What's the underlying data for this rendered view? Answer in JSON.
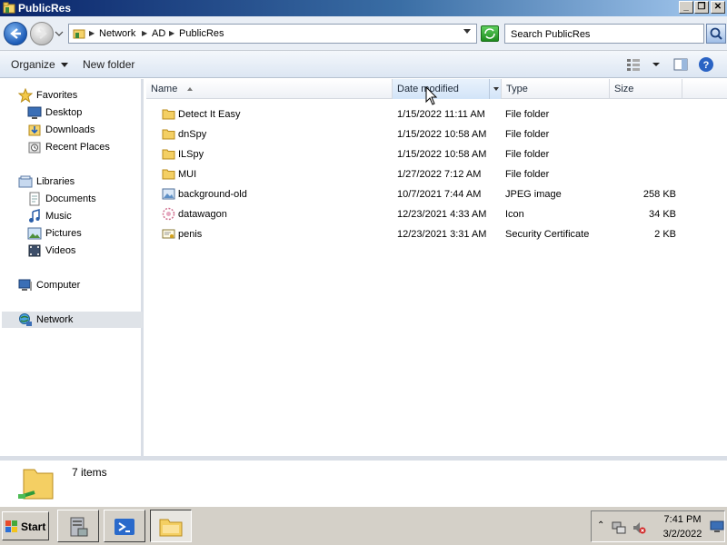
{
  "window": {
    "title": "PublicRes",
    "controls": [
      "minimize",
      "restore",
      "close"
    ]
  },
  "address": {
    "breadcrumbs": [
      "Network",
      "AD",
      "PublicRes"
    ],
    "search_placeholder": "Search PublicRes"
  },
  "toolbar": {
    "organize_label": "Organize",
    "new_folder_label": "New folder"
  },
  "sidebar": {
    "favorites": {
      "label": "Favorites",
      "items": [
        {
          "label": "Desktop",
          "icon": "desktop-icon"
        },
        {
          "label": "Downloads",
          "icon": "downloads-icon"
        },
        {
          "label": "Recent Places",
          "icon": "recent-places-icon"
        }
      ]
    },
    "libraries": {
      "label": "Libraries",
      "items": [
        {
          "label": "Documents",
          "icon": "documents-icon"
        },
        {
          "label": "Music",
          "icon": "music-icon"
        },
        {
          "label": "Pictures",
          "icon": "pictures-icon"
        },
        {
          "label": "Videos",
          "icon": "videos-icon"
        }
      ]
    },
    "computer": {
      "label": "Computer"
    },
    "network": {
      "label": "Network",
      "selected": true
    }
  },
  "list": {
    "columns": [
      "Name",
      "Date modified",
      "Type",
      "Size"
    ],
    "sorted_by": "Name",
    "rows": [
      {
        "name": "Detect It Easy",
        "date": "1/15/2022 11:11 AM",
        "type": "File folder",
        "size": "",
        "icon": "folder-icon"
      },
      {
        "name": "dnSpy",
        "date": "1/15/2022 10:58 AM",
        "type": "File folder",
        "size": "",
        "icon": "folder-icon"
      },
      {
        "name": "ILSpy",
        "date": "1/15/2022 10:58 AM",
        "type": "File folder",
        "size": "",
        "icon": "folder-icon"
      },
      {
        "name": "MUI",
        "date": "1/27/2022 7:12 AM",
        "type": "File folder",
        "size": "",
        "icon": "folder-icon"
      },
      {
        "name": "background-old",
        "date": "10/7/2021 7:44 AM",
        "type": "JPEG image",
        "size": "258 KB",
        "icon": "image-file-icon"
      },
      {
        "name": "datawagon",
        "date": "12/23/2021 4:33 AM",
        "type": "Icon",
        "size": "34 KB",
        "icon": "icon-file-icon"
      },
      {
        "name": "penis",
        "date": "12/23/2021 3:31 AM",
        "type": "Security Certificate",
        "size": "2 KB",
        "icon": "certificate-icon"
      }
    ]
  },
  "details": {
    "item_count": "7 items"
  },
  "taskbar": {
    "start_label": "Start",
    "buttons": [
      "server-manager-icon",
      "powershell-icon",
      "explorer-icon"
    ],
    "active_button": "explorer-icon",
    "clock_time": "7:41 PM",
    "clock_date": "3/2/2022"
  },
  "colors": {
    "title_gradient_start": "#0a246a",
    "title_gradient_end": "#a6caf0",
    "selected_nav_bg": "#dfe3e8",
    "taskbar_bg": "#d4d0c8"
  }
}
